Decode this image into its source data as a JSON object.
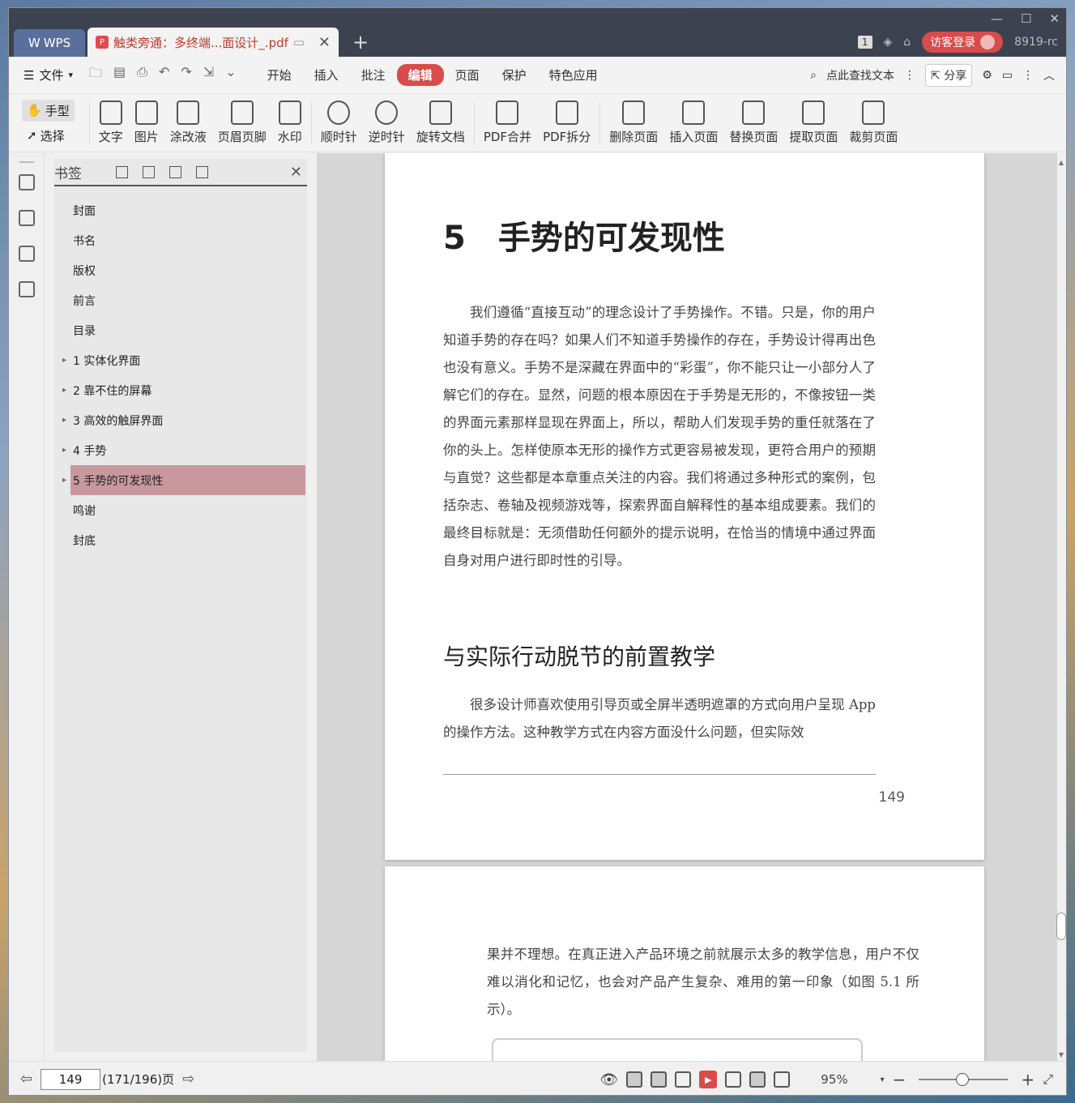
{
  "titlebar": {
    "wps_label": "WPS",
    "doc_tab": "触类旁通：多终端...面设计_.pdf",
    "page_badge": "1",
    "login": "访客登录",
    "user": "8919-rc"
  },
  "menubar": {
    "file": "文件",
    "items": [
      "开始",
      "插入",
      "批注",
      "编辑",
      "页面",
      "保护",
      "特色应用"
    ],
    "active": "编辑",
    "search": "点此查找文本",
    "share": "分享"
  },
  "toolbar": {
    "hand": "手型",
    "select": "选择",
    "tools": [
      "文字",
      "图片",
      "涂改液",
      "页眉页脚",
      "水印",
      "顺时针",
      "逆时针",
      "旋转文档",
      "PDF合并",
      "PDF拆分",
      "删除页面",
      "插入页面",
      "替换页面",
      "提取页面",
      "裁剪页面"
    ]
  },
  "bookmarks": {
    "title": "书签",
    "items": [
      {
        "label": "封面",
        "expandable": false
      },
      {
        "label": "书名",
        "expandable": false
      },
      {
        "label": "版权",
        "expandable": false
      },
      {
        "label": "前言",
        "expandable": false
      },
      {
        "label": "目录",
        "expandable": false
      },
      {
        "label": "1 实体化界面",
        "expandable": true
      },
      {
        "label": "2 靠不住的屏幕",
        "expandable": true
      },
      {
        "label": "3 高效的触屏界面",
        "expandable": true
      },
      {
        "label": "4 手势",
        "expandable": true
      },
      {
        "label": "5 手势的可发现性",
        "expandable": true,
        "selected": true
      },
      {
        "label": "鸣谢",
        "expandable": false
      },
      {
        "label": "封底",
        "expandable": false
      }
    ]
  },
  "page1": {
    "chapter": "5　手势的可发现性",
    "para1": "我们遵循“直接互动”的理念设计了手势操作。不错。只是，你的用户知道手势的存在吗？如果人们不知道手势操作的存在，手势设计得再出色也没有意义。手势不是深藏在界面中的“彩蛋”，你不能只让一小部分人了解它们的存在。显然，问题的根本原因在于手势是无形的，不像按钮一类的界面元素那样显现在界面上，所以，帮助人们发现手势的重任就落在了你的头上。怎样使原本无形的操作方式更容易被发现，更符合用户的预期与直觉？这些都是本章重点关注的内容。我们将通过多种形式的案例，包括杂志、卷轴及视频游戏等，探索界面自解释性的基本组成要素。我们的最终目标就是：无须借助任何额外的提示说明，在恰当的情境中通过界面自身对用户进行即时性的引导。",
    "heading": "与实际行动脱节的前置教学",
    "para2": "很多设计师喜欢使用引导页或全屏半透明遮罩的方式向用户呈现 App 的操作方法。这种教学方式在内容方面没什么问题，但实际效",
    "page_number": "149"
  },
  "page2": {
    "para": "果并不理想。在真正进入产品环境之前就展示太多的教学信息，用户不仅难以消化和记忆，也会对产品产生复杂、难用的第一印象（如图 5.1 所示）。"
  },
  "status": {
    "page_input": "149",
    "page_info": "(171/196)页",
    "zoom": "95%"
  }
}
